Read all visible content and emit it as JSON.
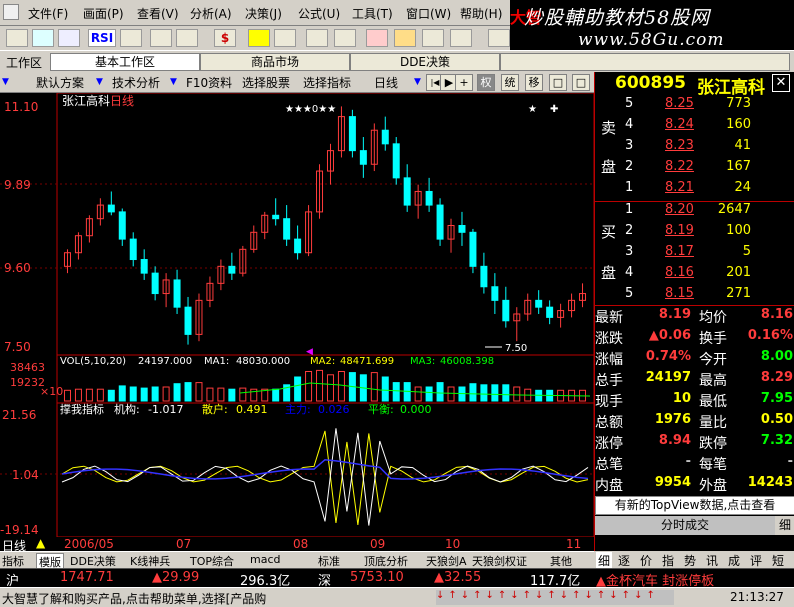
{
  "menu": {
    "items": [
      "文件(F)",
      "画面(P)",
      "查看(V)",
      "分析(A)",
      "决策(J)",
      "公式(U)",
      "工具(T)",
      "窗口(W)",
      "帮助(H)"
    ],
    "brand": "大智"
  },
  "banner": {
    "line1": "炒股輔助教材58股网",
    "line2": "www.58Gu.com"
  },
  "toolbar": {
    "rsi": "RSI"
  },
  "tabs": {
    "label": "工作区",
    "items": [
      "基本工作区",
      "商品市场",
      "DDE决策"
    ]
  },
  "funcbar": {
    "items": [
      "默认方案",
      "技术分析",
      "F10资料",
      "选择股票",
      "选择指标",
      "日线"
    ],
    "buttons": [
      "|◀",
      "▶",
      "+",
      "权",
      "统",
      "移",
      "□",
      "□"
    ]
  },
  "stock": {
    "code": "600895",
    "name": "张江高科",
    "period": "日线"
  },
  "chart": {
    "price_labels": [
      "11.10",
      "9.89",
      "9.60",
      "7.50"
    ],
    "low_note": "7.50",
    "vol_caption": "VOL(5,10,20)",
    "vol_val": "24197.000",
    "ma1_lbl": "MA1:",
    "ma1": "48030.000",
    "ma2_lbl": "MA2:",
    "ma2": "48471.699",
    "ma3_lbl": "MA3:",
    "ma3": "46008.398",
    "vol_axis": [
      "38463",
      "19232",
      "×10"
    ],
    "ind_caption": "撑我指标",
    "ind_a_lbl": "机构:",
    "ind_a": "-1.017",
    "ind_b_lbl": "散户:",
    "ind_b": "0.491",
    "ind_c_lbl": "主力:",
    "ind_c": "0.026",
    "ind_d_lbl": "平衡:",
    "ind_d": "0.000",
    "ind_axis": [
      "21.56",
      "1.04",
      "-19.14"
    ],
    "dates": [
      "2006/05",
      "07",
      "08",
      "09",
      "10",
      "11"
    ],
    "period_tag": "日线"
  },
  "chart_data": {
    "type": "candlestick",
    "title": "张江高科 日线",
    "ylim": [
      7.5,
      11.1
    ],
    "candles": [
      [
        8.7,
        8.95,
        8.6,
        8.9
      ],
      [
        8.9,
        9.2,
        8.8,
        9.15
      ],
      [
        9.15,
        9.45,
        9.05,
        9.4
      ],
      [
        9.4,
        9.7,
        9.3,
        9.6
      ],
      [
        9.6,
        9.8,
        9.45,
        9.5
      ],
      [
        9.5,
        9.55,
        9.0,
        9.1
      ],
      [
        9.1,
        9.2,
        8.7,
        8.8
      ],
      [
        8.8,
        8.95,
        8.5,
        8.6
      ],
      [
        8.6,
        8.7,
        8.2,
        8.3
      ],
      [
        8.3,
        8.6,
        8.1,
        8.5
      ],
      [
        8.5,
        8.65,
        8.0,
        8.1
      ],
      [
        8.1,
        8.25,
        7.55,
        7.7
      ],
      [
        7.7,
        8.3,
        7.6,
        8.2
      ],
      [
        8.2,
        8.55,
        8.1,
        8.45
      ],
      [
        8.45,
        8.8,
        8.35,
        8.7
      ],
      [
        8.7,
        8.9,
        8.5,
        8.6
      ],
      [
        8.6,
        9.0,
        8.55,
        8.95
      ],
      [
        8.95,
        9.3,
        8.9,
        9.2
      ],
      [
        9.2,
        9.5,
        9.1,
        9.45
      ],
      [
        9.45,
        9.7,
        9.3,
        9.4
      ],
      [
        9.4,
        9.6,
        9.0,
        9.1
      ],
      [
        9.1,
        9.3,
        8.8,
        8.9
      ],
      [
        8.9,
        9.6,
        8.85,
        9.5
      ],
      [
        9.5,
        10.2,
        9.4,
        10.1
      ],
      [
        10.1,
        10.5,
        9.9,
        10.4
      ],
      [
        10.4,
        11.05,
        10.3,
        10.9
      ],
      [
        10.9,
        11.0,
        10.3,
        10.4
      ],
      [
        10.4,
        10.6,
        10.0,
        10.2
      ],
      [
        10.2,
        10.8,
        10.1,
        10.7
      ],
      [
        10.7,
        10.9,
        10.4,
        10.5
      ],
      [
        10.5,
        10.6,
        9.9,
        10.0
      ],
      [
        10.0,
        10.2,
        9.5,
        9.6
      ],
      [
        9.6,
        9.9,
        9.4,
        9.8
      ],
      [
        9.8,
        10.0,
        9.5,
        9.6
      ],
      [
        9.6,
        9.7,
        9.0,
        9.1
      ],
      [
        9.1,
        9.4,
        8.9,
        9.3
      ],
      [
        9.3,
        9.5,
        9.0,
        9.2
      ],
      [
        9.2,
        9.25,
        8.6,
        8.7
      ],
      [
        8.7,
        8.9,
        8.3,
        8.4
      ],
      [
        8.4,
        8.6,
        8.0,
        8.2
      ],
      [
        8.2,
        8.4,
        7.8,
        7.9
      ],
      [
        7.9,
        8.1,
        7.6,
        8.0
      ],
      [
        8.0,
        8.3,
        7.9,
        8.2
      ],
      [
        8.2,
        8.35,
        8.0,
        8.1
      ],
      [
        8.1,
        8.2,
        7.85,
        7.95
      ],
      [
        7.95,
        8.15,
        7.8,
        8.05
      ],
      [
        8.05,
        8.3,
        7.95,
        8.2
      ],
      [
        8.2,
        8.45,
        8.1,
        8.3
      ]
    ],
    "volume_ylim": [
      0,
      38463
    ],
    "indicator_ylim": [
      -19.14,
      21.56
    ]
  },
  "quotes": {
    "sell_label": [
      "卖",
      "盘"
    ],
    "buy_label": [
      "买",
      "盘"
    ],
    "sell": [
      [
        "5",
        "8.25",
        "773"
      ],
      [
        "4",
        "8.24",
        "160"
      ],
      [
        "3",
        "8.23",
        "41"
      ],
      [
        "2",
        "8.22",
        "167"
      ],
      [
        "1",
        "8.21",
        "24"
      ]
    ],
    "buy": [
      [
        "1",
        "8.20",
        "2647"
      ],
      [
        "2",
        "8.19",
        "100"
      ],
      [
        "3",
        "8.17",
        "5"
      ],
      [
        "4",
        "8.16",
        "201"
      ],
      [
        "5",
        "8.15",
        "271"
      ]
    ],
    "stats": [
      [
        "最新",
        "8.19",
        "均价",
        "8.16"
      ],
      [
        "涨跌",
        "▲0.06",
        "换手",
        "0.16%"
      ],
      [
        "涨幅",
        "0.74%",
        "今开",
        "8.00"
      ],
      [
        "总手",
        "24197",
        "最高",
        "8.29"
      ],
      [
        "现手",
        "10",
        "最低",
        "7.95"
      ],
      [
        "总额",
        "1976",
        "量比",
        "0.50"
      ],
      [
        "涨停",
        "8.94",
        "跌停",
        "7.32"
      ],
      [
        "总笔",
        "-",
        "每笔",
        "-"
      ],
      [
        "内盘",
        "9954",
        "外盘",
        "14243"
      ]
    ],
    "notice": "有新的TopView数据,点击查看",
    "detail": "分时成交",
    "detail2": "细"
  },
  "bottom_tabs": [
    "指标",
    "模版",
    "DDE决策",
    "K线神兵",
    "TOP综合",
    "macd",
    "标准",
    "顶底分析",
    "天狼剑A",
    "天狼剑权证",
    "其他"
  ],
  "right_tabs": [
    "细",
    "逐",
    "价",
    "指",
    "势",
    "讯",
    "成",
    "评",
    "短"
  ],
  "ticker": {
    "sh_lbl": "沪",
    "sh": "1747.71",
    "sh_chg": "▲29.99",
    "sh_amt": "296.3亿",
    "sz_lbl": "深",
    "sz": "5753.10",
    "sz_chg": "▲32.55",
    "sz_amt": "117.7亿",
    "news": "▲金杯汽车 封涨停板"
  },
  "status": {
    "text": "大智慧了解和购买产品,点击帮助菜单,选择[产品购",
    "time": "21:13:27"
  }
}
